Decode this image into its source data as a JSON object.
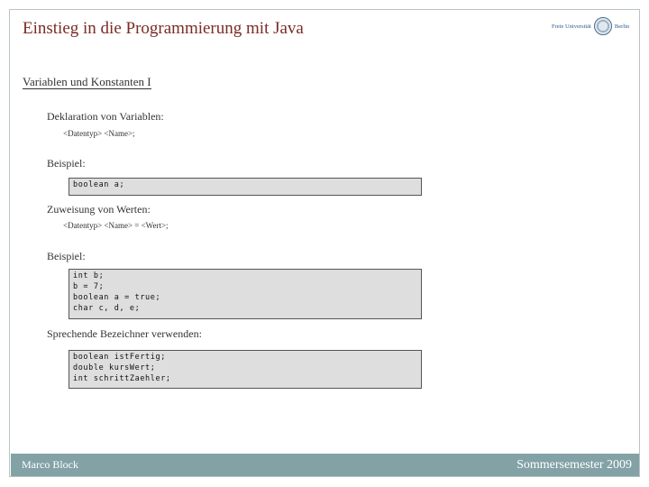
{
  "header": {
    "title": "Einstieg in die Programmierung mit Java",
    "logo": {
      "left_text": "Freie Universität",
      "right_text": "Berlin",
      "icon": "university-seal-icon"
    }
  },
  "slide": {
    "subtitle": "Variablen und Konstanten I",
    "sections": [
      {
        "heading": "Deklaration von Variablen:",
        "syntax": "<Datentyp> <Name>;"
      },
      {
        "heading": "Beispiel:",
        "code": [
          "boolean a;"
        ]
      },
      {
        "heading": "Zuweisung von Werten:",
        "syntax": "<Datentyp> <Name> = <Wert>;"
      },
      {
        "heading": "Beispiel:",
        "code": [
          "int b;",
          "b = 7;",
          "boolean a = true;",
          "char c, d, e;"
        ]
      },
      {
        "heading": "Sprechende Bezeichner verwenden:",
        "code": [
          "boolean istFertig;",
          "double kursWert;",
          "int schrittZaehler;"
        ]
      }
    ]
  },
  "footer": {
    "author": "Marco Block",
    "semester": "Sommersemester 2009"
  },
  "colors": {
    "title": "#7a2b24",
    "footer_bg": "#83a2a6",
    "code_bg": "#dedede"
  }
}
